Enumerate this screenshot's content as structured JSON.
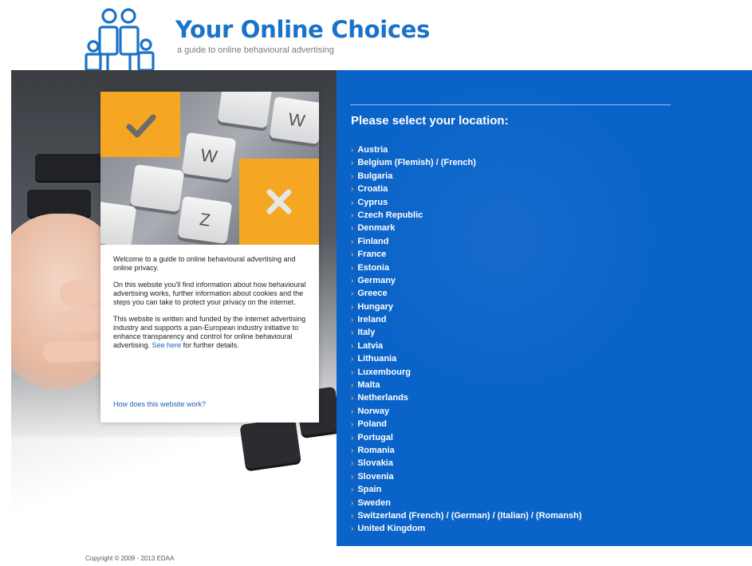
{
  "header": {
    "title": "Your Online Choices",
    "tagline": "a guide to online behavioural advertising"
  },
  "colors": {
    "brand_blue": "#1a73c8",
    "panel_blue": "#0a63c9",
    "accent_orange": "#f5a623",
    "link_blue": "#1a5fb4"
  },
  "card": {
    "keys": [
      "W",
      "W",
      "Z"
    ],
    "paragraph1": "Welcome to a guide to online behavioural advertising and online privacy.",
    "paragraph2": "On this website you'll find information about how behavioural advertising works, further information about cookies and the steps you can take to protect your privacy on the internet.",
    "paragraph3_text": "This website is written and funded by the internet advertising industry and supports a pan-European industry initiative to enhance transparency and control for online behavioural advertising.",
    "paragraph3_link": "See here",
    "paragraph3_tail": "for further details.",
    "how_link": "How does this website work?"
  },
  "location": {
    "heading": "Please select your location:",
    "countries": [
      "Austria",
      "Belgium (Flemish) / (French)",
      "Bulgaria",
      "Croatia",
      "Cyprus",
      "Czech Republic",
      "Denmark",
      "Finland",
      "France",
      "Estonia",
      "Germany",
      "Greece",
      "Hungary",
      "Ireland",
      "Italy",
      "Latvia",
      "Lithuania",
      "Luxembourg",
      "Malta",
      "Netherlands",
      "Norway",
      "Poland",
      "Portugal",
      "Romania",
      "Slovakia",
      "Slovenia",
      "Spain",
      "Sweden",
      "Switzerland (French) / (German) / (Italian) / (Romansh)",
      "United Kingdom"
    ]
  },
  "footer": {
    "copyright": "Copyright © 2009 - 2013 EDAA"
  }
}
